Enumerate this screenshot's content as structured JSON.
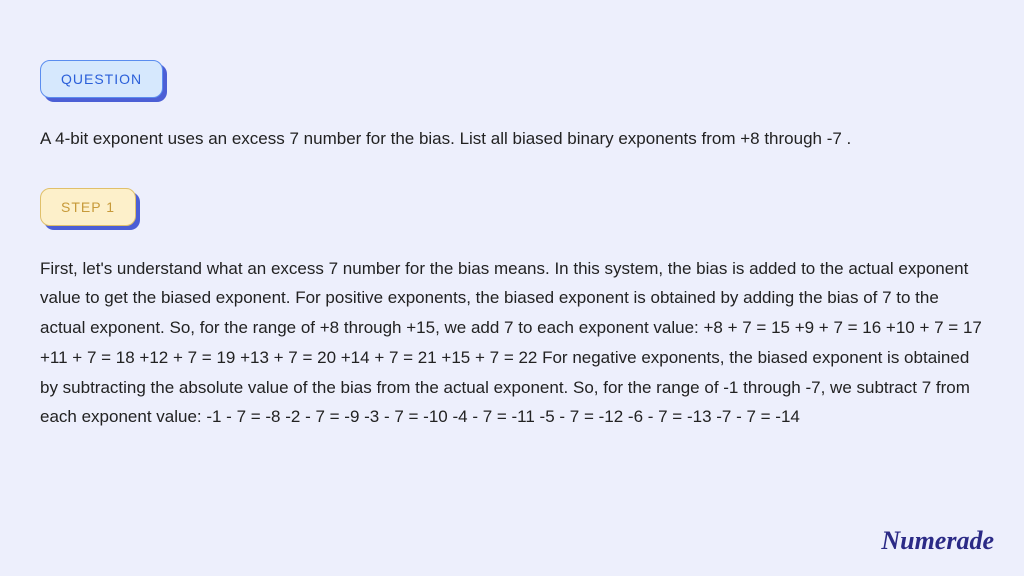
{
  "badges": {
    "question": "QUESTION",
    "step1": "STEP 1"
  },
  "question_text": "A 4-bit exponent uses an excess 7 number for the bias. List all biased binary exponents from +8 through -7 .",
  "step1_text": "First, let's understand what an excess 7 number for the bias means. In this system, the bias is added to the actual exponent value to get the biased exponent. For positive exponents, the biased exponent is obtained by adding the bias of 7 to the actual exponent. So, for the range of +8 through +15, we add 7 to each exponent value: +8 + 7 = 15 +9 + 7 = 16 +10 + 7 = 17 +11 + 7 = 18 +12 + 7 = 19 +13 + 7 = 20 +14 + 7 = 21 +15 + 7 = 22 For negative exponents, the biased exponent is obtained by subtracting the absolute value of the bias from the actual exponent. So, for the range of -1 through -7, we subtract 7 from each exponent value: -1 - 7 = -8 -2 - 7 = -9 -3 - 7 = -10 -4 - 7 = -11 -5 - 7 = -12 -6 - 7 = -13 -7 - 7 = -14",
  "brand": "Numerade"
}
